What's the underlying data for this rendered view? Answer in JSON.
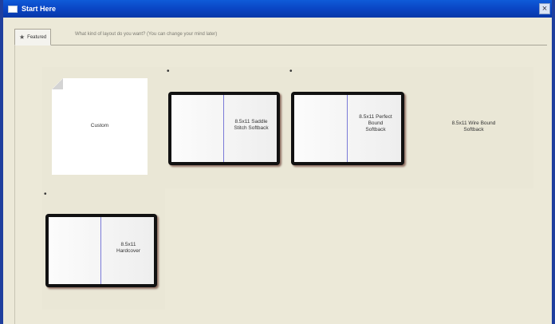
{
  "window": {
    "title": "Start Here",
    "close_glyph": "×",
    "app_icon": "window-icon"
  },
  "tabs": [
    {
      "label": "Featured",
      "icon": "star-icon",
      "selected": true
    }
  ],
  "hint_text": "What kind of layout do you want? (You can change your mind later)",
  "layouts": [
    {
      "id": "custom",
      "label": "Custom",
      "indicator": ""
    },
    {
      "id": "saddle-stitch",
      "label": "8.5x11 Saddle\nStitch Softback",
      "indicator": "•"
    },
    {
      "id": "perfect-bound",
      "label": "8.5x11 Perfect\nBound\nSoftback",
      "indicator": "•"
    },
    {
      "id": "wire-bound",
      "label": "8.5x11 Wire Bound\nSoftback",
      "indicator": ""
    },
    {
      "id": "hardcover",
      "label": "8.5x11\nHardcover",
      "indicator": "•"
    }
  ]
}
